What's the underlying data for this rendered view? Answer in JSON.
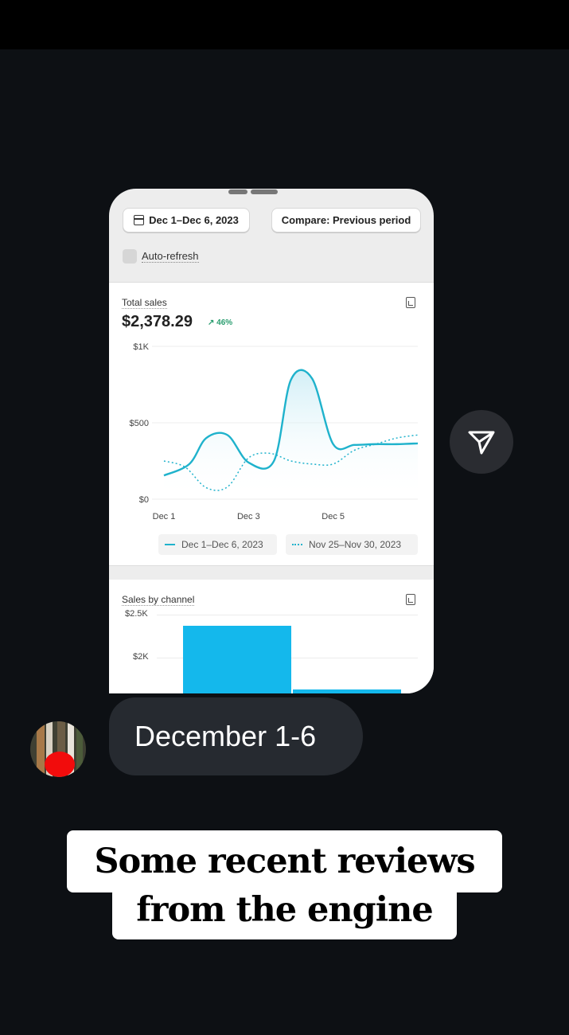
{
  "story": {
    "message_text": "December 1-6",
    "caption_line1": "Some recent reviews",
    "caption_line2": "from the engine"
  },
  "dashboard": {
    "date_range_button": "Dec 1–Dec 6, 2023",
    "compare_button": "Compare: Previous period",
    "auto_refresh_label": "Auto-refresh",
    "total_sales": {
      "title": "Total sales",
      "value": "$2,378.29",
      "delta": "46%",
      "delta_arrow": "↗",
      "legend_current": "Dec 1–Dec 6, 2023",
      "legend_previous": "Nov 25–Nov 30, 2023"
    },
    "sales_by_channel": {
      "title": "Sales by channel",
      "y_ticks": [
        "$2.5K",
        "$2K"
      ]
    }
  },
  "colors": {
    "accent": "#1fb2cc",
    "bar": "#14b8ec",
    "positive": "#2a9d6f",
    "background": "#0d1014"
  },
  "chart_data": {
    "type": "line",
    "title": "Total sales",
    "x_ticks": [
      "Dec 1",
      "Dec 3",
      "Dec 5"
    ],
    "y_ticks": [
      "$1K",
      "$500",
      "$0"
    ],
    "ylim": [
      0,
      1000
    ],
    "series": [
      {
        "name": "Dec 1–Dec 6, 2023",
        "style": "solid",
        "x": [
          0,
          0.6,
          1,
          1.5,
          2,
          2.6,
          3,
          3.5,
          4,
          4.5,
          5,
          5.5,
          6
        ],
        "y": [
          155,
          230,
          400,
          420,
          240,
          250,
          780,
          790,
          360,
          355,
          360,
          360,
          365
        ]
      },
      {
        "name": "Nov 25–Nov 30, 2023",
        "style": "dotted",
        "x": [
          0,
          0.5,
          1,
          1.5,
          2,
          2.5,
          3,
          3.5,
          4,
          4.5,
          5,
          5.5,
          6
        ],
        "y": [
          250,
          210,
          75,
          80,
          270,
          300,
          250,
          230,
          230,
          320,
          360,
          400,
          420
        ]
      }
    ]
  }
}
